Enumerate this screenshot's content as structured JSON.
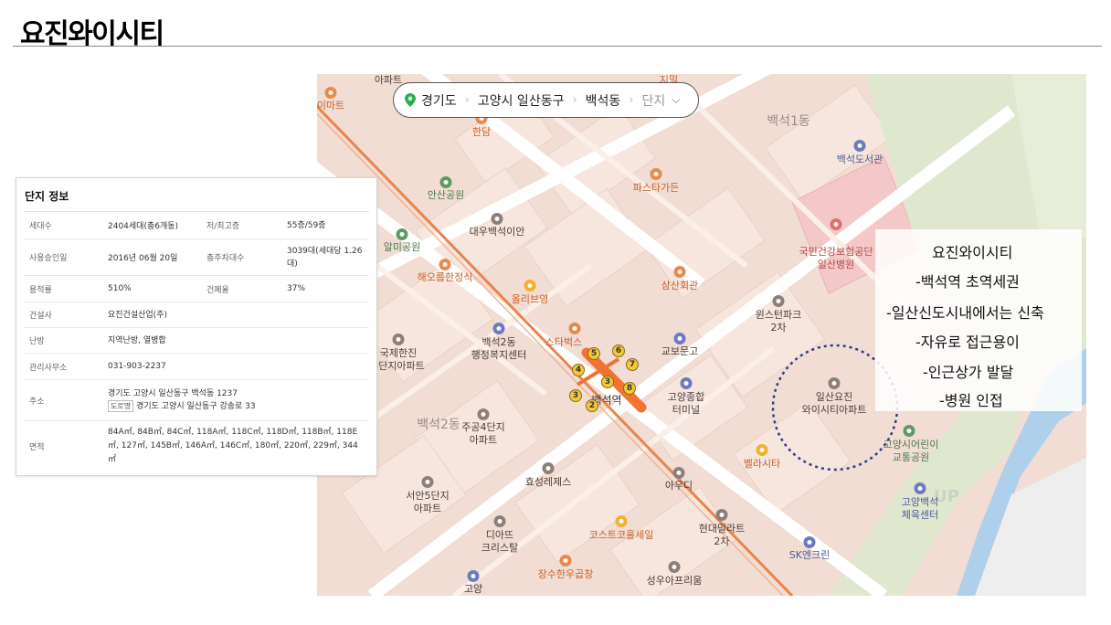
{
  "page": {
    "title": "요진와이시티"
  },
  "breadcrumb": {
    "items": [
      "경기도",
      "고양시 일산동구",
      "백석동"
    ],
    "last": "단지"
  },
  "callout": {
    "lines": [
      "요진와이시티",
      "-백석역 초역세권",
      "-일산신도시내에서는 신축",
      "-자유로 접근용이",
      "-인근상가 발달",
      "-병원 인접"
    ]
  },
  "info": {
    "title": "단지 정보",
    "households_label": "세대수",
    "households": "2404세대(총6개동)",
    "floors_label": "저/최고층",
    "floors": "55층/59층",
    "approval_label": "사용승인일",
    "approval": "2016년 06월 20일",
    "parking_label": "총주차대수",
    "parking": "3039대(세대당 1.26대)",
    "far_label": "용적률",
    "far": "510%",
    "bcr_label": "건폐율",
    "bcr": "37%",
    "builder_label": "건설사",
    "builder": "요진건설산업(주)",
    "heating_label": "난방",
    "heating": "지역난방, 열병합",
    "office_label": "관리사무소",
    "office": "031-903-2237",
    "address_label": "주소",
    "address": "경기도 고양시 일산동구 백석동 1237",
    "road_tag": "도로명",
    "road_address": "경기도 고양시 일산동구 강송로 33",
    "area_label": "면적",
    "area": "84A㎡, 84B㎡, 84C㎡, 118A㎡, 118C㎡, 118D㎡, 118B㎡, 118E㎡, 127㎡, 145B㎡, 146A㎡, 146C㎡, 180㎡, 220㎡, 229㎡, 344㎡"
  },
  "map": {
    "labels": {
      "apt_top": "아파트",
      "mart": "이마트",
      "handam": "한담",
      "baekseok1": "백석1동",
      "library": "백석도서관",
      "ansan_park": "안산공원",
      "pasta": "파스타가든",
      "daewoo": "대우백석이안",
      "alme_park": "알미공원",
      "hospital": "국민건강보험공단\n일산병원",
      "haeoreum": "해오름한정식",
      "samsan": "삼산회관",
      "olive": "올리브영",
      "winstone": "윈스턴파크\n2차",
      "starbucks": "스타벅스",
      "community": "백석2동\n행정복지센터",
      "gukje": "국제한진\n3단지아파트",
      "kyobo": "교보문고",
      "station": "백석역",
      "terminal": "고양종합\n터미널",
      "yojin": "일산요진\n와이시티아파트",
      "baekseok2": "백석2동",
      "jugong": "주공4단지\n아파트",
      "bellacita": "벨라시타",
      "children_park": "고양시어린이\n교통공원",
      "hyosung": "효성레제스",
      "seoan": "서안5단지\n아파트",
      "audi": "아우디",
      "sports": "고양백석\n체육센터",
      "costco": "코스트코홀세일",
      "diatto": "디아뜨\n크리스탈",
      "hyundai": "현대밀라트\n2차",
      "sk": "SK엔크린",
      "jangsu": "장수한우곱창",
      "seongwoo": "성우아프리움",
      "goyang": "고양",
      "jimil": "지밀"
    },
    "exits": [
      "1",
      "2",
      "3",
      "4",
      "5",
      "6",
      "7",
      "8"
    ]
  }
}
